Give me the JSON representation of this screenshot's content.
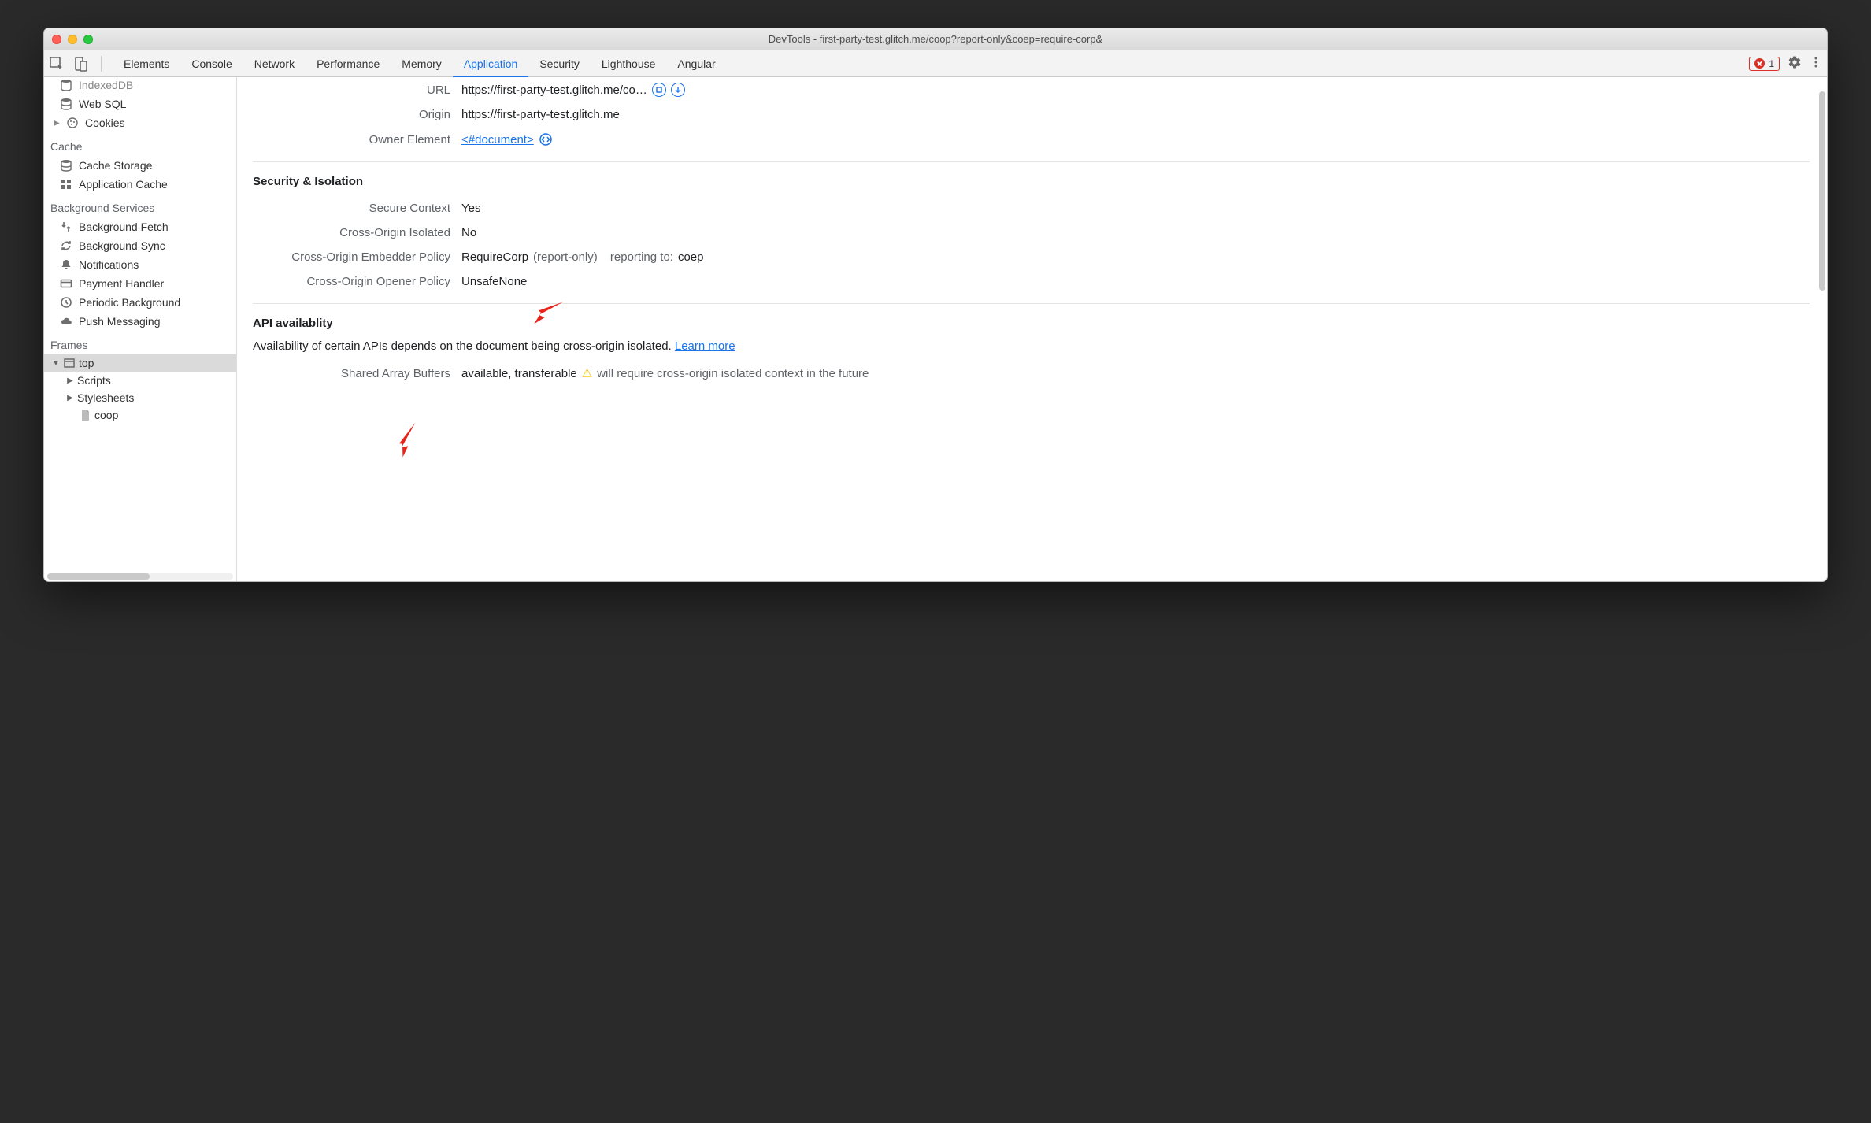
{
  "window_title": "DevTools - first-party-test.glitch.me/coop?report-only&coep=require-corp&",
  "tabs": [
    "Elements",
    "Console",
    "Network",
    "Performance",
    "Memory",
    "Application",
    "Security",
    "Lighthouse",
    "Angular"
  ],
  "active_tab_index": 5,
  "error_count": "1",
  "sidebar": {
    "cutoff_item": "IndexedDB",
    "storage_items": [
      "Web SQL",
      "Cookies"
    ],
    "cache_label": "Cache",
    "cache_items": [
      "Cache Storage",
      "Application Cache"
    ],
    "bg_label": "Background Services",
    "bg_items": [
      "Background Fetch",
      "Background Sync",
      "Notifications",
      "Payment Handler",
      "Periodic Background",
      "Push Messaging"
    ],
    "frames_label": "Frames",
    "frames": {
      "top": "top",
      "children": [
        "Scripts",
        "Stylesheets"
      ],
      "leaf": "coop"
    }
  },
  "document": {
    "url_label": "URL",
    "url_value": "https://first-party-test.glitch.me/co…",
    "origin_label": "Origin",
    "origin_value": "https://first-party-test.glitch.me",
    "owner_label": "Owner Element",
    "owner_value": "<#document>"
  },
  "sec": {
    "title": "Security & Isolation",
    "secure_ctx_label": "Secure Context",
    "secure_ctx_value": "Yes",
    "coi_label": "Cross-Origin Isolated",
    "coi_value": "No",
    "coep_label": "Cross-Origin Embedder Policy",
    "coep_value": "RequireCorp",
    "coep_mode": "(report-only)",
    "coep_report_prefix": "reporting to:",
    "coep_report_value": "coep",
    "coop_label": "Cross-Origin Opener Policy",
    "coop_value": "UnsafeNone"
  },
  "api": {
    "title": "API availablity",
    "desc": "Availability of certain APIs depends on the document being cross-origin isolated. ",
    "learn_more": "Learn more",
    "sab_label": "Shared Array Buffers",
    "sab_value": "available, transferable",
    "sab_warn": "will require cross-origin isolated context in the future"
  }
}
